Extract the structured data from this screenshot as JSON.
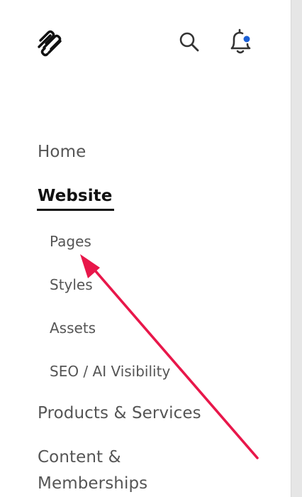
{
  "header": {
    "logo_icon": "squarespace-logo-icon",
    "search_icon": "search-icon",
    "bell_icon": "notification-bell-icon",
    "notification_dot_color": "#1a5fd6"
  },
  "nav": {
    "home": "Home",
    "website": "Website",
    "website_children": {
      "pages": "Pages",
      "styles": "Styles",
      "assets": "Assets",
      "seo": "SEO / AI Visibility"
    },
    "products": "Products & Services",
    "content_line1": "Content &",
    "content_line2": "Memberships"
  },
  "annotation": {
    "arrow_color": "#e8174a",
    "points_to": "Pages"
  }
}
